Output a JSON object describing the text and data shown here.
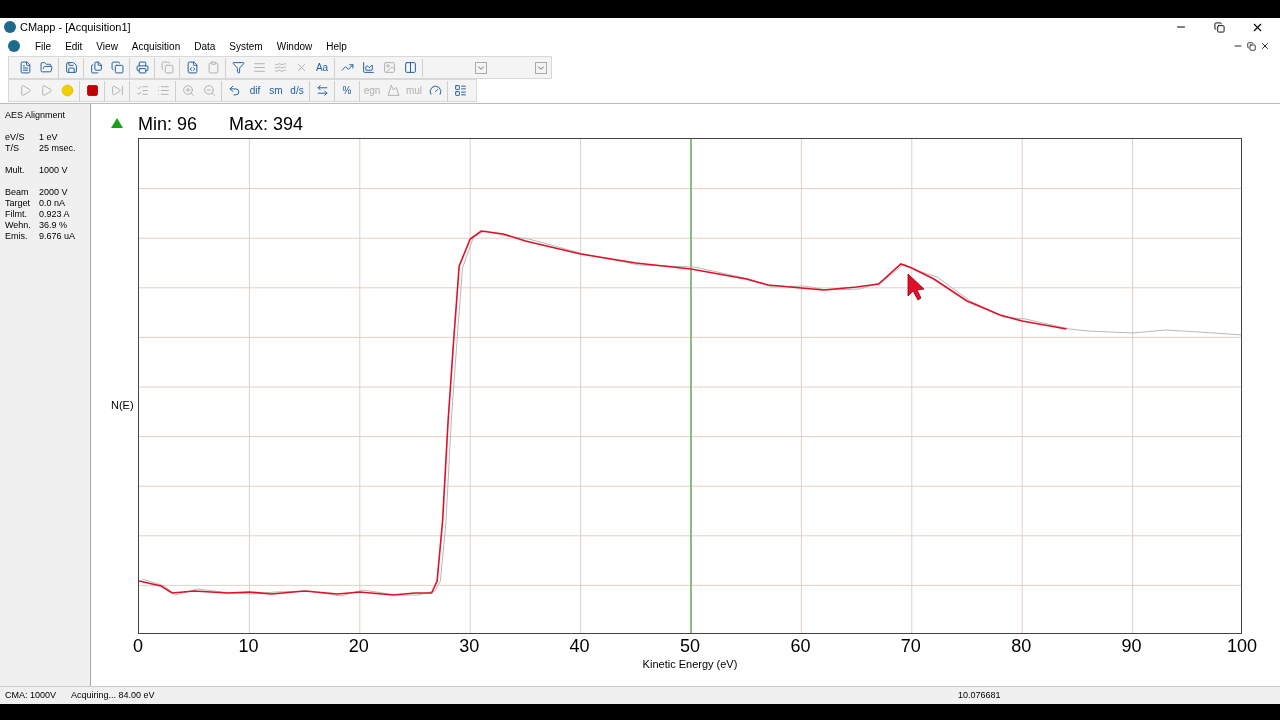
{
  "window": {
    "title": "CMapp - [Acquisition1]"
  },
  "menu": [
    "File",
    "Edit",
    "View",
    "Acquisition",
    "Data",
    "System",
    "Window",
    "Help"
  ],
  "toolbar_1": [
    [
      {
        "disabled": false
      },
      {
        "disabled": false
      }
    ],
    [
      {
        "disabled": false
      }
    ],
    [
      {
        "disabled": false
      },
      {
        "disabled": false
      }
    ],
    [
      {
        "disabled": false
      }
    ],
    [
      {
        "disabled": true
      }
    ],
    [
      {
        "disabled": false
      },
      {
        "disabled": true
      }
    ],
    [
      {
        "disabled": false
      },
      {
        "disabled": true
      },
      {
        "disabled": true
      },
      {
        "disabled": true
      },
      {
        "label": "Aa",
        "disabled": false
      }
    ],
    [
      {
        "disabled": false
      },
      {
        "disabled": false
      },
      {
        "disabled": true
      },
      {
        "disabled": false
      }
    ]
  ],
  "toolbar_2": [
    [
      {
        "disabled": true
      },
      {
        "disabled": true
      },
      {
        "disabled": false
      }
    ],
    [
      {
        "disabled": false
      }
    ],
    [
      {
        "disabled": true
      }
    ],
    [
      {
        "disabled": true
      },
      {
        "disabled": true
      }
    ],
    [
      {
        "disabled": true
      },
      {
        "disabled": true
      }
    ],
    [
      {
        "disabled": false
      },
      {
        "label": "dif",
        "disabled": false
      },
      {
        "label": "sm",
        "disabled": false
      },
      {
        "label": "d/s",
        "disabled": false
      }
    ],
    [
      {
        "disabled": false
      }
    ],
    [
      {
        "label": "%",
        "disabled": false
      }
    ],
    [
      {
        "label": "egn",
        "disabled": true
      },
      {
        "disabled": true
      },
      {
        "label": "mul",
        "disabled": true
      },
      {
        "disabled": false
      }
    ],
    [
      {
        "disabled": false
      }
    ]
  ],
  "side_panel": {
    "title": "AES Alignment",
    "groups": [
      [
        {
          "label": "eV/S",
          "value": "1 eV"
        },
        {
          "label": "T/S",
          "value": "25 msec."
        }
      ],
      [
        {
          "label": "Mult.",
          "value": "1000 V"
        }
      ],
      [
        {
          "label": "Beam",
          "value": "2000 V"
        },
        {
          "label": "Target",
          "value": "0.0 nA"
        },
        {
          "label": "Filmt.",
          "value": "0.923 A"
        },
        {
          "label": "Wehn.",
          "value": "36.9 %"
        },
        {
          "label": "Emis.",
          "value": "9.676 uA"
        }
      ]
    ]
  },
  "plot": {
    "min": "Min: 96",
    "max": "Max: 394",
    "ylabel": "N(E)",
    "xlabel": "Kinetic Energy (eV)",
    "xticks": [
      "0",
      "10",
      "20",
      "30",
      "40",
      "50",
      "60",
      "70",
      "80",
      "90",
      "100"
    ]
  },
  "status_bar": [
    "CMA: 1000V",
    "Acquiring... 84.00 eV",
    "10.076681"
  ]
}
